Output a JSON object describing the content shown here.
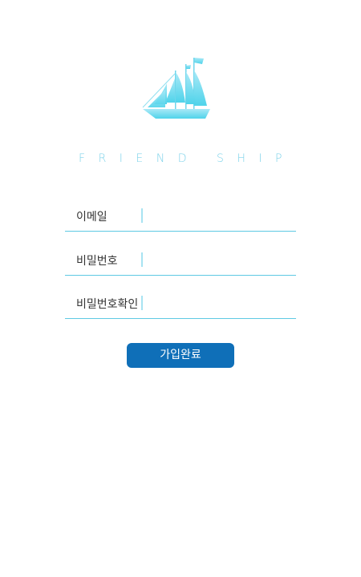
{
  "brand": {
    "title": "FRIEND SHIP",
    "logo_icon": "sailing-ship-icon",
    "accent_color": "#7fd3ea"
  },
  "form": {
    "fields": [
      {
        "label": "이메일",
        "value": "",
        "placeholder": ""
      },
      {
        "label": "비밀번호",
        "value": "",
        "placeholder": ""
      },
      {
        "label": "비밀번호확인",
        "value": "",
        "placeholder": ""
      }
    ],
    "submit_label": "가입완료",
    "submit_color": "#0f6fb8",
    "underline_color": "#5ec9e3"
  }
}
